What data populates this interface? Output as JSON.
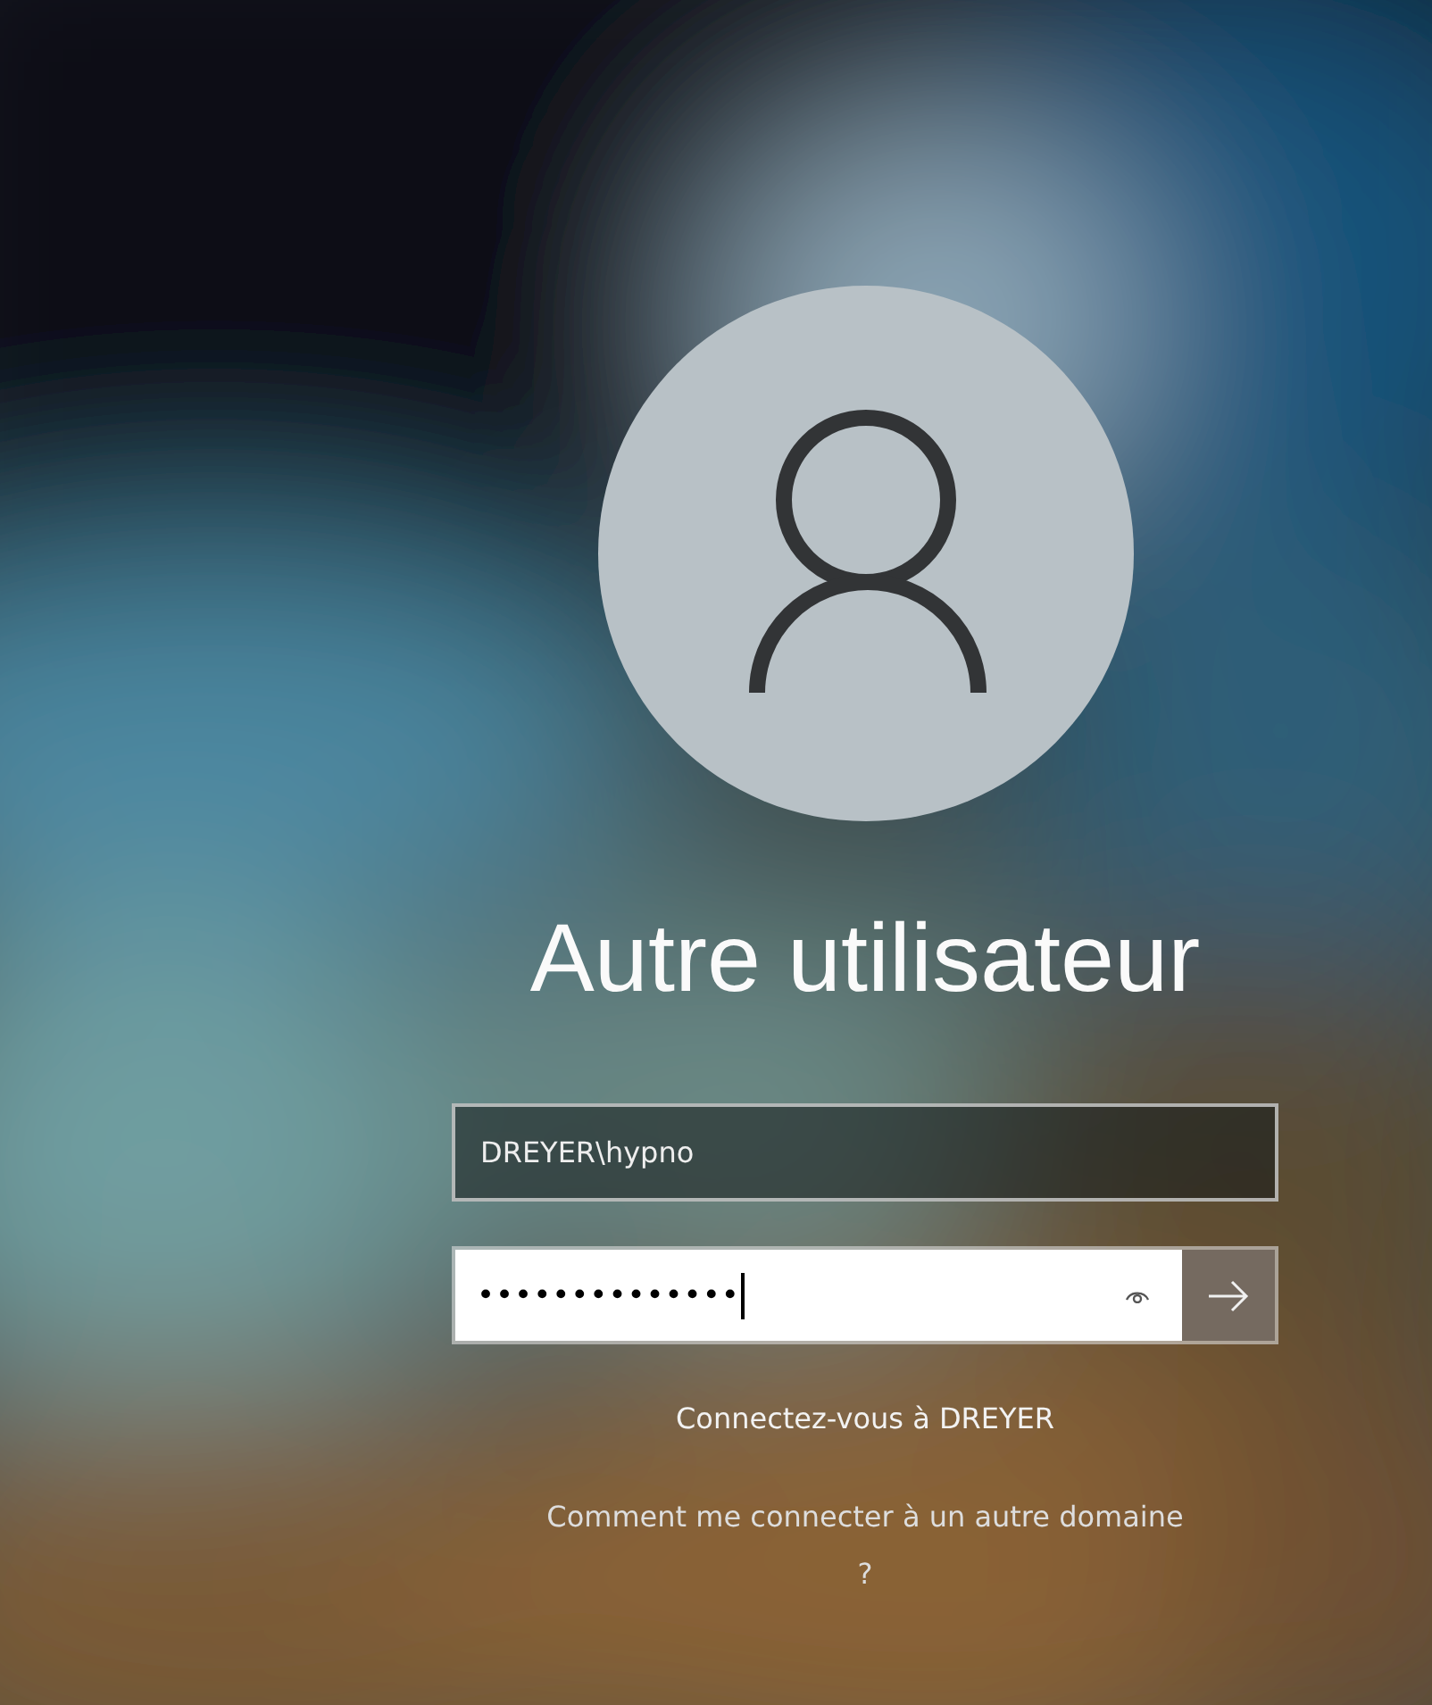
{
  "user": {
    "name": "Autre utilisateur"
  },
  "username_field": {
    "value": "DREYER\\hypno"
  },
  "password_field": {
    "value": "••••••••••••••",
    "focused": true
  },
  "sign_in_to": "Connectez-vous à DREYER",
  "other_domain_link": "Comment me connecter à un autre domaine ?"
}
